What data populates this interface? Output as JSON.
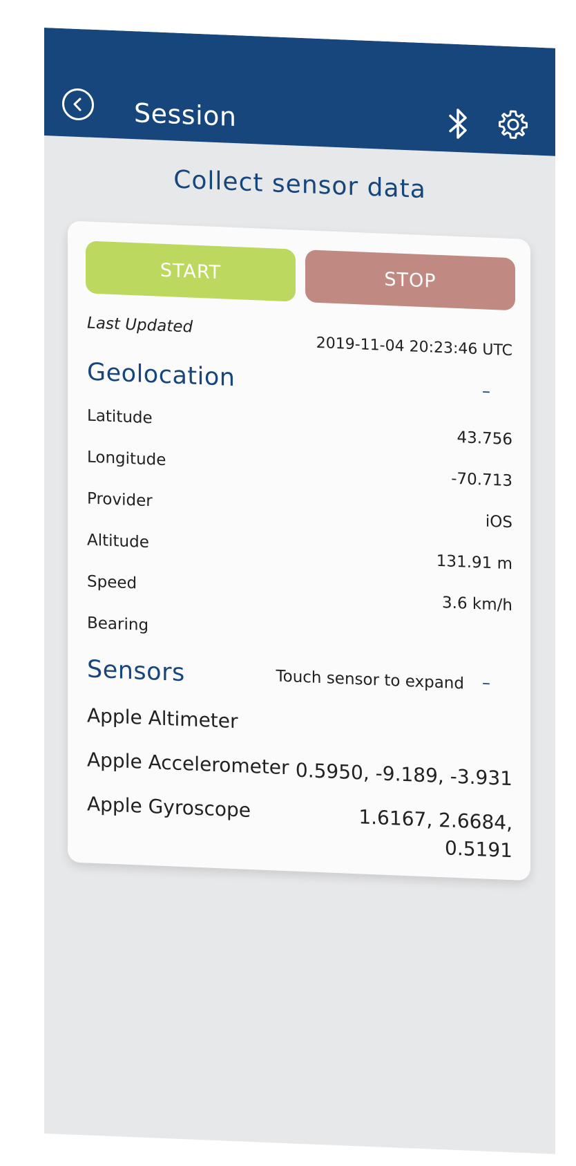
{
  "header": {
    "title": "Session",
    "back_icon": "chevron-left-circle-icon",
    "bluetooth_icon": "bluetooth-icon",
    "settings_icon": "gear-icon"
  },
  "page_title": "Collect sensor data",
  "controls": {
    "start_label": "START",
    "stop_label": "STOP"
  },
  "last_updated": {
    "label": "Last Updated",
    "value": "2019-11-04 20:23:46 UTC"
  },
  "geolocation": {
    "title": "Geolocation",
    "collapse": "–",
    "rows": [
      {
        "label": "Latitude",
        "value": "43.756"
      },
      {
        "label": "Longitude",
        "value": "-70.713"
      },
      {
        "label": "Provider",
        "value": "iOS"
      },
      {
        "label": "Altitude",
        "value": "131.91 m"
      },
      {
        "label": "Speed",
        "value": "3.6 km/h"
      },
      {
        "label": "Bearing",
        "value": ""
      }
    ]
  },
  "sensors": {
    "title": "Sensors",
    "hint": "Touch sensor to expand",
    "collapse": "–",
    "items": [
      {
        "label": "Apple Altimeter",
        "value": ""
      },
      {
        "label": "Apple Accelerometer",
        "value": "0.5950, -9.189, -3.931"
      },
      {
        "label": "Apple Gyroscope",
        "value": "1.6167, 2.6684,",
        "value2": "0.5191"
      }
    ]
  },
  "colors": {
    "header": "#17467d",
    "start": "#bcd85f",
    "stop": "#c08a82",
    "background": "#e7e8ea",
    "card": "#fbfbfb"
  }
}
